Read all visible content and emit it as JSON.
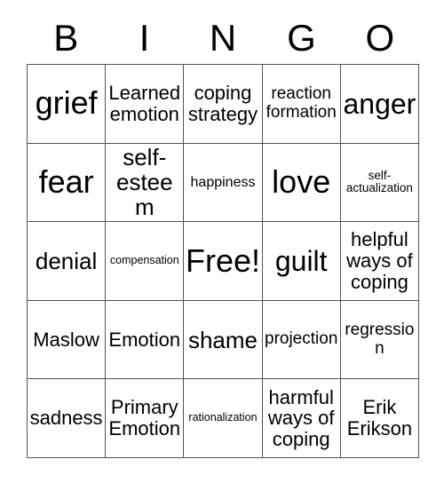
{
  "card": {
    "title": "BINGO",
    "free_space_label": "Free!",
    "header_letters": [
      "B",
      "I",
      "N",
      "G",
      "O"
    ],
    "columns": 5,
    "rows": 5,
    "colors": {
      "background": "#ffffff",
      "text": "#000000",
      "grid_line": "#555555"
    },
    "cells": [
      [
        {
          "text": "grief",
          "size": "fs-xxl"
        },
        {
          "text": "Learned emotion",
          "size": "fs-m"
        },
        {
          "text": "coping strategy",
          "size": "fs-m"
        },
        {
          "text": "reaction formation",
          "size": "fs-s"
        },
        {
          "text": "anger",
          "size": "fs-xl"
        }
      ],
      [
        {
          "text": "fear",
          "size": "fs-xxl"
        },
        {
          "text": "self-esteem",
          "size": "fs-l"
        },
        {
          "text": "happiness",
          "size": "fs-xs"
        },
        {
          "text": "love",
          "size": "fs-xxl"
        },
        {
          "text": "self-actualization",
          "size": "fs-xxs"
        }
      ],
      [
        {
          "text": "denial",
          "size": "fs-l"
        },
        {
          "text": "compensation",
          "size": "fs-tiny"
        },
        {
          "text": "Free!",
          "size": "fs-xxl"
        },
        {
          "text": "guilt",
          "size": "fs-xl"
        },
        {
          "text": "helpful ways of coping",
          "size": "fs-m"
        }
      ],
      [
        {
          "text": "Maslow",
          "size": "fs-m"
        },
        {
          "text": "Emotion",
          "size": "fs-m"
        },
        {
          "text": "shame",
          "size": "fs-l"
        },
        {
          "text": "projection",
          "size": "fs-s"
        },
        {
          "text": "regression",
          "size": "fs-s"
        }
      ],
      [
        {
          "text": "sadness",
          "size": "fs-m"
        },
        {
          "text": "Primary Emotion",
          "size": "fs-m"
        },
        {
          "text": "rationalization",
          "size": "fs-tiny"
        },
        {
          "text": "harmful ways of coping",
          "size": "fs-m"
        },
        {
          "text": "Erik Erikson",
          "size": "fs-m"
        }
      ]
    ]
  }
}
